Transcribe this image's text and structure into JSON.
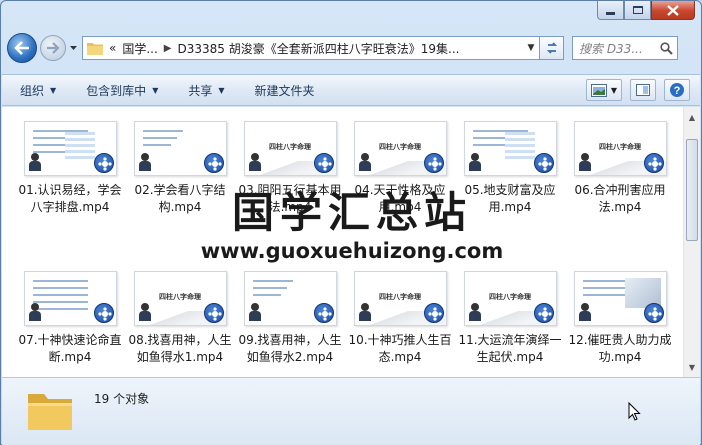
{
  "window": {
    "caption_buttons": [
      "minimize",
      "maximize",
      "close"
    ]
  },
  "nav": {
    "address_root": "国学...",
    "address_path": "D33385 胡浚豪《全套新派四柱八字旺衰法》19集...",
    "search_placeholder": "搜索 D33..."
  },
  "toolbar": {
    "organize": "组织",
    "include_in_library": "包含到库中",
    "share": "共享",
    "new_folder": "新建文件夹"
  },
  "files": [
    {
      "name": "01.认识易经，学会八字排盘.mp4",
      "thumb": "chart"
    },
    {
      "name": "02.学会看八字结构.mp4",
      "thumb": "text"
    },
    {
      "name": "03.阴阳五行基本用法.mp4",
      "thumb": "title",
      "thumb_title": "四柱八字命理"
    },
    {
      "name": "04.天干性格及应用.mp4",
      "thumb": "title",
      "thumb_title": "四柱八字命理"
    },
    {
      "name": "05.地支财富及应用.mp4",
      "thumb": "diagram"
    },
    {
      "name": "06.合冲刑害应用法.mp4",
      "thumb": "title",
      "thumb_title": "四柱八字命理"
    },
    {
      "name": "07.十神快速论命直断.mp4",
      "thumb": "table"
    },
    {
      "name": "08.找喜用神，人生如鱼得水1.mp4",
      "thumb": "title",
      "thumb_title": "四柱八字命理"
    },
    {
      "name": "09.找喜用神，人生如鱼得水2.mp4",
      "thumb": "text"
    },
    {
      "name": "10.十神巧推人生百态.mp4",
      "thumb": "title",
      "thumb_title": "四柱八字命理"
    },
    {
      "name": "11.大运流年演绎一生起伏.mp4",
      "thumb": "title",
      "thumb_title": "四柱八字命理"
    },
    {
      "name": "12.催旺贵人助力成功.mp4",
      "thumb": "photo"
    }
  ],
  "watermark": {
    "line1": "国学汇总站",
    "line2": "www.guoxuehuizong.com"
  },
  "details": {
    "count": "19 个对象"
  }
}
